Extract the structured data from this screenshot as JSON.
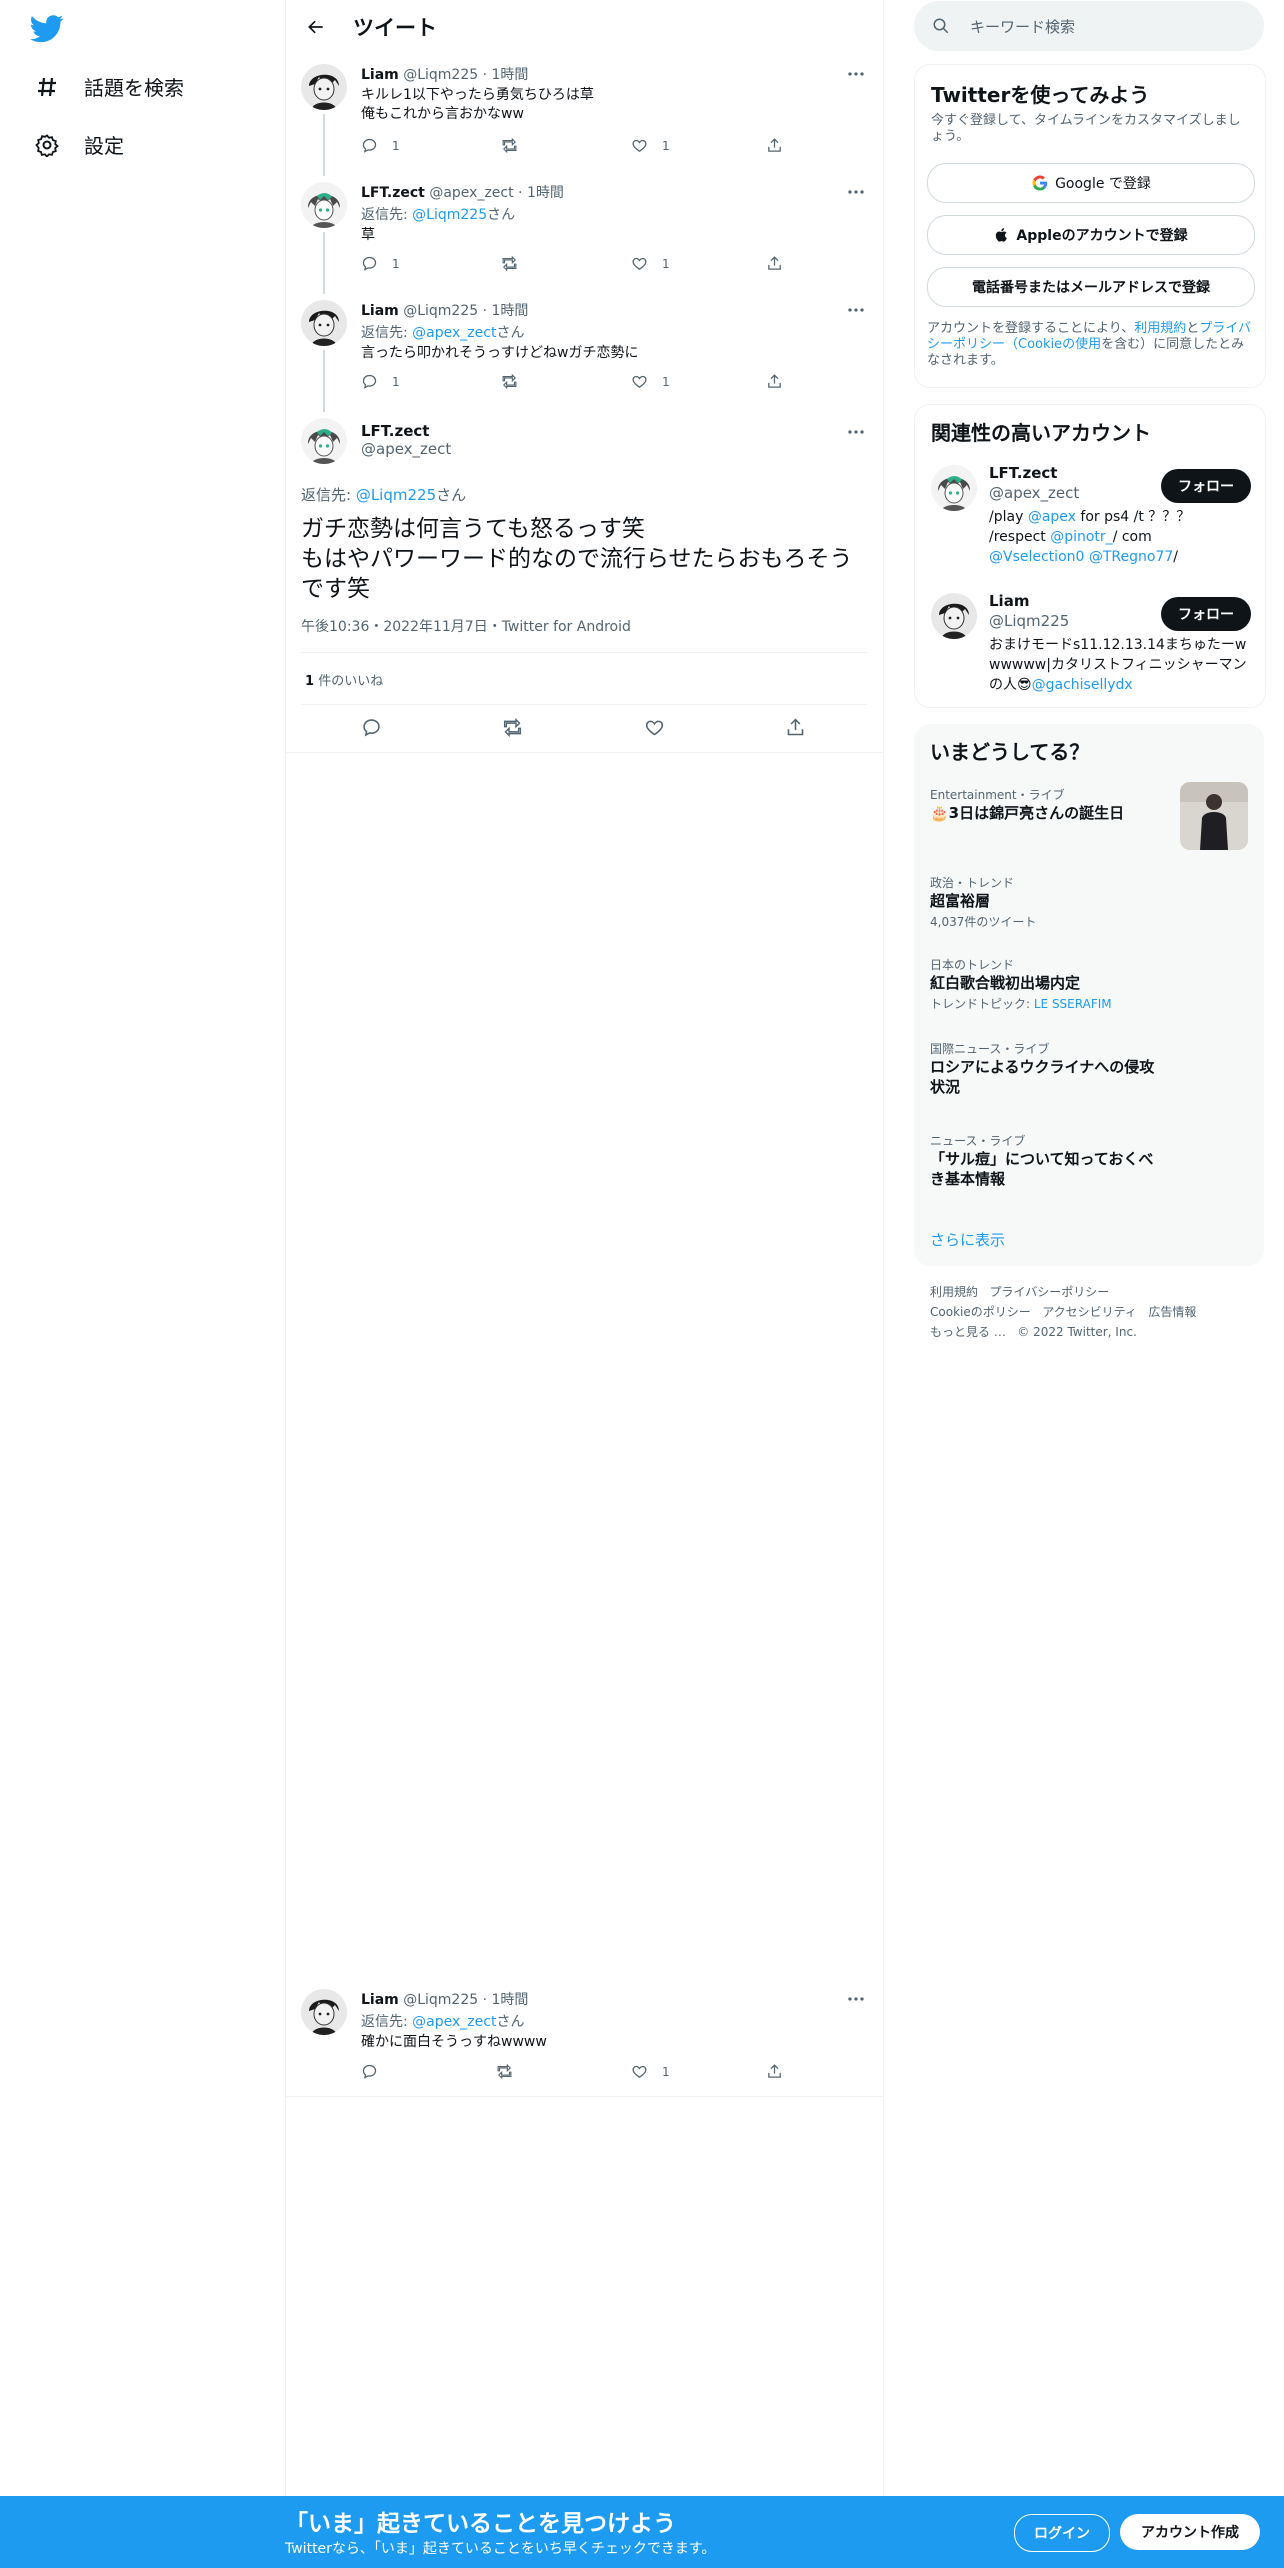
{
  "nav": {
    "explore_label": "話題を検索",
    "settings_label": "設定"
  },
  "header": {
    "title": "ツイート"
  },
  "tweets": [
    {
      "name": "Liam",
      "handle": "@Liqm225",
      "time": "1時間",
      "text": "キルレ1以下やったら勇気ちひろは草\n俺もこれから言おかなww",
      "reply_count": "1",
      "like_count": "1"
    },
    {
      "name": "LFT.zect",
      "handle": "@apex_zect",
      "time": "1時間",
      "reply_prefix": "返信先: ",
      "reply_to": "@Liqm225",
      "reply_suffix": "さん",
      "text": "草",
      "reply_count": "1",
      "like_count": "1"
    },
    {
      "name": "Liam",
      "handle": "@Liqm225",
      "time": "1時間",
      "reply_prefix": "返信先: ",
      "reply_to": "@apex_zect",
      "reply_suffix": "さん",
      "text": "言ったら叩かれそうっすけどねwガチ恋勢に",
      "reply_count": "1",
      "like_count": "1"
    }
  ],
  "focus": {
    "name": "LFT.zect",
    "handle": "@apex_zect",
    "reply_prefix": "返信先: ",
    "reply_to": "@Liqm225",
    "reply_suffix": "さん",
    "text": "ガチ恋勢は何言うても怒るっす笑\nもはやパワーワード的なので流行らせたらおもろそうです笑",
    "timestamp": "午後10:36・2022年11月7日・Twitter for Android",
    "likes_num": "1",
    "likes_label": "件のいいね"
  },
  "reply": {
    "name": "Liam",
    "handle": "@Liqm225",
    "time": "1時間",
    "reply_prefix": "返信先: ",
    "reply_to": "@apex_zect",
    "reply_suffix": "さん",
    "text": "確かに面白そうっすねwwww",
    "like_count": "1"
  },
  "search": {
    "placeholder": "キーワード検索"
  },
  "signup_card": {
    "title": "Twitterを使ってみよう",
    "subtitle": "今すぐ登録して、タイムラインをカスタマイズしましょう。",
    "google": "Google で登録",
    "apple": "Appleのアカウントで登録",
    "phone": "電話番号またはメールアドレスで登録",
    "terms_pre": "アカウントを登録することにより、",
    "terms_link": "利用規約",
    "terms_and": "と",
    "privacy_link": "プライバシーポリシー（Cookieの使用",
    "terms_post": "を含む）に同意したとみなされます。"
  },
  "recommend": {
    "title": "関連性の高いアカウント",
    "follow_label": "フォロー",
    "accounts": [
      {
        "name": "LFT.zect",
        "handle": "@apex_zect",
        "bio_1": "/play ",
        "bio_link1": "@apex",
        "bio_2": " for ps4 /t ？？？ /respect ",
        "bio_link2": "@pinotr_",
        "bio_3": "/ com ",
        "bio_link3": "@Vselection0",
        "bio_4": " ",
        "bio_link4": "@TRegno77",
        "bio_5": "/"
      },
      {
        "name": "Liam",
        "handle": "@Liqm225",
        "bio_1": "おまけモードs11.12.13.14まちゅたーwwwwww|カタリストフィニッシャーマンの人😎",
        "bio_link1": "@gachisellydx"
      }
    ]
  },
  "trends": {
    "title": "いまどうしてる？",
    "items": [
      {
        "category": "Entertainment・ライブ",
        "title": "🎂3日は錦戸亮さんの誕生日"
      },
      {
        "category": "政治・トレンド",
        "title": "超富裕層",
        "sub": "4,037件のツイート"
      },
      {
        "category": "日本のトレンド",
        "title": "紅白歌合戦初出場内定",
        "sub_pre": "トレンドトピック: ",
        "sub_link": "LE SSERAFIM"
      },
      {
        "category": "国際ニュース・ライブ",
        "title": "ロシアによるウクライナへの侵攻状況"
      },
      {
        "category": "ニュース・ライブ",
        "title": "「サル痘」について知っておくべき基本情報"
      }
    ],
    "show_more": "さらに表示"
  },
  "footer": {
    "terms": "利用規約",
    "privacy": "プライバシーポリシー",
    "cookie": "Cookieのポリシー",
    "accessibility": "アクセシビリティ",
    "ads": "広告情報",
    "more": "もっと見る …",
    "copyright": "© 2022 Twitter, Inc."
  },
  "bottom_bar": {
    "headline": "「いま」起きていることを見つけよう",
    "subline": "Twitterなら、「いま」起きていることをいち早くチェックできます。",
    "login": "ログイン",
    "signup": "アカウント作成"
  },
  "colors": {
    "accent": "#1d9bf0",
    "text": "#0f1419",
    "muted": "#536471"
  },
  "icons": [
    "twitter-logo-icon",
    "hashtag-icon",
    "gear-icon",
    "back-arrow-icon",
    "search-icon",
    "reply-icon",
    "retweet-icon",
    "like-icon",
    "share-icon",
    "more-icon",
    "google-icon",
    "apple-icon"
  ]
}
